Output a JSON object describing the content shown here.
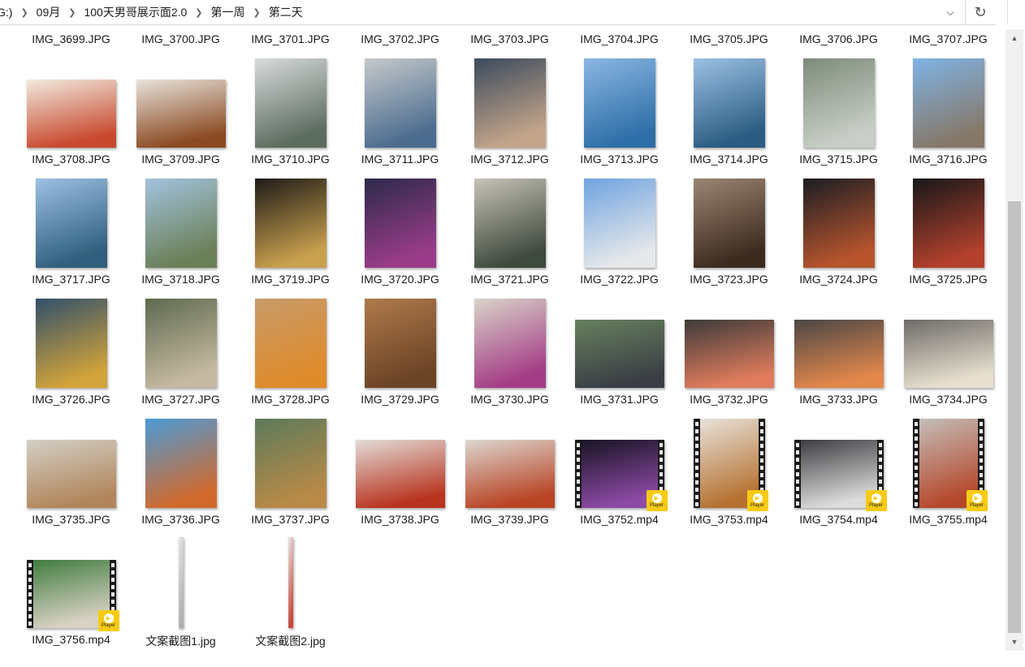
{
  "address_bar": {
    "crumbs": [
      "G:)",
      "09月",
      "100天男哥展示面2.0",
      "第一周",
      "第二天"
    ],
    "dropdown_icon": "chevron-down-icon",
    "refresh_icon": "refresh-icon"
  },
  "rows": [
    {
      "items": [
        {
          "name": "IMG_3699.JPG"
        },
        {
          "name": "IMG_3700.JPG"
        },
        {
          "name": "IMG_3701.JPG"
        },
        {
          "name": "IMG_3702.JPG"
        },
        {
          "name": "IMG_3703.JPG"
        },
        {
          "name": "IMG_3704.JPG"
        },
        {
          "name": "IMG_3705.JPG"
        },
        {
          "name": "IMG_3706.JPG"
        },
        {
          "name": "IMG_3707.JPG"
        }
      ]
    },
    {
      "items": [
        {
          "name": "IMG_3708.JPG",
          "kind": "photo",
          "orient": "land",
          "c1": "#f1ebe0",
          "c2": "#c8492e"
        },
        {
          "name": "IMG_3709.JPG",
          "kind": "photo",
          "orient": "land",
          "c1": "#e8e3dc",
          "c2": "#8b4a22"
        },
        {
          "name": "IMG_3710.JPG",
          "kind": "photo",
          "orient": "port",
          "c1": "#d9dcdc",
          "c2": "#5b6b5f"
        },
        {
          "name": "IMG_3711.JPG",
          "kind": "photo",
          "orient": "port",
          "c1": "#c6c9cb",
          "c2": "#4b6c8f"
        },
        {
          "name": "IMG_3712.JPG",
          "kind": "photo",
          "orient": "port",
          "c1": "#3b4a5d",
          "c2": "#c4a58a"
        },
        {
          "name": "IMG_3713.JPG",
          "kind": "photo",
          "orient": "port",
          "c1": "#8ab6e2",
          "c2": "#2e6fa8"
        },
        {
          "name": "IMG_3714.JPG",
          "kind": "photo",
          "orient": "port",
          "c1": "#9cc1e4",
          "c2": "#2b5c82"
        },
        {
          "name": "IMG_3715.JPG",
          "kind": "photo",
          "orient": "port",
          "c1": "#7d8c79",
          "c2": "#c9cfc8"
        },
        {
          "name": "IMG_3716.JPG",
          "kind": "photo",
          "orient": "port",
          "c1": "#7fb3e5",
          "c2": "#867869"
        }
      ]
    },
    {
      "items": [
        {
          "name": "IMG_3717.JPG",
          "kind": "photo",
          "orient": "port",
          "c1": "#9dc0e4",
          "c2": "#2f5f7d"
        },
        {
          "name": "IMG_3718.JPG",
          "kind": "photo",
          "orient": "port",
          "c1": "#a2c3de",
          "c2": "#6b7f57"
        },
        {
          "name": "IMG_3719.JPG",
          "kind": "photo",
          "orient": "port",
          "c1": "#1e1b18",
          "c2": "#c9a04e"
        },
        {
          "name": "IMG_3720.JPG",
          "kind": "photo",
          "orient": "port",
          "c1": "#2c2a4a",
          "c2": "#9b3c8a"
        },
        {
          "name": "IMG_3721.JPG",
          "kind": "photo",
          "orient": "port",
          "c1": "#c7c2b6",
          "c2": "#3f4a3e"
        },
        {
          "name": "IMG_3722.JPG",
          "kind": "photo",
          "orient": "port",
          "c1": "#6fa3e0",
          "c2": "#e6e8ea"
        },
        {
          "name": "IMG_3723.JPG",
          "kind": "photo",
          "orient": "port",
          "c1": "#9b8672",
          "c2": "#3d2a1f"
        },
        {
          "name": "IMG_3724.JPG",
          "kind": "photo",
          "orient": "port",
          "c1": "#1a1d24",
          "c2": "#b8552d"
        },
        {
          "name": "IMG_3725.JPG",
          "kind": "photo",
          "orient": "port",
          "c1": "#151719",
          "c2": "#b3412d"
        }
      ]
    },
    {
      "items": [
        {
          "name": "IMG_3726.JPG",
          "kind": "photo",
          "orient": "port",
          "c1": "#31506b",
          "c2": "#d1a33a"
        },
        {
          "name": "IMG_3727.JPG",
          "kind": "photo",
          "orient": "port",
          "c1": "#5d6a4d",
          "c2": "#c6b9a2"
        },
        {
          "name": "IMG_3728.JPG",
          "kind": "photo",
          "orient": "port",
          "c1": "#c79b6a",
          "c2": "#e08b2a"
        },
        {
          "name": "IMG_3729.JPG",
          "kind": "photo",
          "orient": "port",
          "c1": "#b07a4b",
          "c2": "#6b4326"
        },
        {
          "name": "IMG_3730.JPG",
          "kind": "photo",
          "orient": "port",
          "c1": "#d9d4c9",
          "c2": "#a43c86"
        },
        {
          "name": "IMG_3731.JPG",
          "kind": "photo",
          "orient": "land",
          "c1": "#67805f",
          "c2": "#3b3f45"
        },
        {
          "name": "IMG_3732.JPG",
          "kind": "photo",
          "orient": "land",
          "c1": "#3d3b3b",
          "c2": "#e07c5c"
        },
        {
          "name": "IMG_3733.JPG",
          "kind": "photo",
          "orient": "land",
          "c1": "#4a4746",
          "c2": "#e3874b"
        },
        {
          "name": "IMG_3734.JPG",
          "kind": "photo",
          "orient": "land",
          "c1": "#6e6b68",
          "c2": "#e8e0cf"
        }
      ]
    },
    {
      "items": [
        {
          "name": "IMG_3735.JPG",
          "kind": "photo",
          "orient": "land",
          "c1": "#d3cfc5",
          "c2": "#b1865c"
        },
        {
          "name": "IMG_3736.JPG",
          "kind": "photo",
          "orient": "port",
          "c1": "#4b9bd6",
          "c2": "#d2692c"
        },
        {
          "name": "IMG_3737.JPG",
          "kind": "photo",
          "orient": "port",
          "c1": "#5c7a5b",
          "c2": "#b98a47"
        },
        {
          "name": "IMG_3738.JPG",
          "kind": "photo",
          "orient": "land",
          "c1": "#e2ddd8",
          "c2": "#b8341f"
        },
        {
          "name": "IMG_3739.JPG",
          "kind": "photo",
          "orient": "land",
          "c1": "#dcd6d0",
          "c2": "#b84424"
        },
        {
          "name": "IMG_3752.mp4",
          "kind": "video",
          "orient": "land",
          "c1": "#161321",
          "c2": "#8d4aa6",
          "badge": "Player"
        },
        {
          "name": "IMG_3753.mp4",
          "kind": "video",
          "orient": "port",
          "c1": "#e9e5df",
          "c2": "#b5702f",
          "badge": "Player"
        },
        {
          "name": "IMG_3754.mp4",
          "kind": "video",
          "orient": "land",
          "c1": "#3a3b3e",
          "c2": "#dcdcdc",
          "badge": "Player"
        },
        {
          "name": "IMG_3755.mp4",
          "kind": "video",
          "orient": "port",
          "c1": "#c4c1bd",
          "c2": "#b5472a",
          "badge": "Player"
        }
      ]
    },
    {
      "items": [
        {
          "name": "IMG_3756.mp4",
          "kind": "video",
          "orient": "land",
          "c1": "#3e7a3d",
          "c2": "#d9d2c4",
          "badge": "Player"
        },
        {
          "name": "文案截图1.jpg",
          "kind": "strip",
          "c1": "#e6e6e6",
          "c2": "#b0b0b0"
        },
        {
          "name": "文案截图2.jpg",
          "kind": "strip",
          "c1": "#e9e9e9",
          "c2": "#c44a3a"
        }
      ]
    }
  ]
}
